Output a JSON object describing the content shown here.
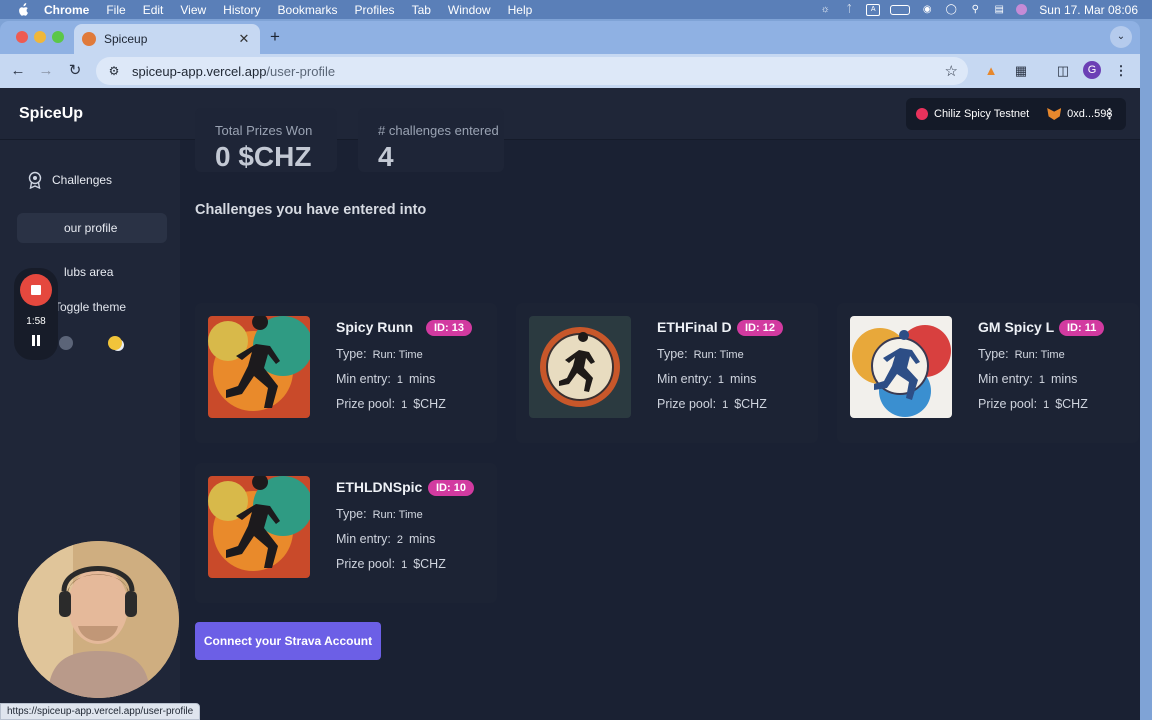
{
  "menubar": {
    "app_name": "Chrome",
    "items": [
      "File",
      "Edit",
      "View",
      "History",
      "Bookmarks",
      "Profiles",
      "Tab",
      "Window",
      "Help"
    ],
    "clock": "Sun 17. Mar  08:06",
    "status_icons": [
      "brightness-icon",
      "bluetooth-icon",
      "text-input-icon",
      "battery-icon",
      "wifi-icon",
      "user-icon",
      "spotlight-icon",
      "control-center-icon",
      "siri-icon"
    ]
  },
  "browser": {
    "tab_title": "Spiceup",
    "url_host": "spiceup-app.vercel.app",
    "url_path": "/user-profile",
    "profile_letter": "G",
    "status_url": "https://spiceup-app.vercel.app/user-profile"
  },
  "app": {
    "brand": "SpiceUp",
    "network": "Chiliz Spicy Testnet",
    "wallet": "0xd...598"
  },
  "sidebar": {
    "items": [
      {
        "label": "Challenges",
        "icon": "award-icon"
      },
      {
        "label": "our profile",
        "icon": "user-icon"
      },
      {
        "label": "lubs area",
        "icon": "clubs-icon"
      }
    ],
    "toggle_theme": "Toggle theme"
  },
  "recorder": {
    "elapsed": "1:58"
  },
  "stats": [
    {
      "label": "Total Prizes Won",
      "value": "0 $CHZ"
    },
    {
      "label": "# challenges entered",
      "value": "4"
    }
  ],
  "section_title": "Challenges you have entered into",
  "labels": {
    "type": "Type:",
    "min_entry": "Min entry:",
    "prize_pool": "Prize pool:",
    "mins": "mins",
    "currency": "$CHZ"
  },
  "challenges": [
    {
      "name": "Spicy Runn",
      "badge": "ID: 13",
      "type": "Run: Time",
      "min_entry": "1",
      "prize_pool": "1"
    },
    {
      "name": "ETHFinal D",
      "badge": "ID: 12",
      "type": "Run: Time",
      "min_entry": "1",
      "prize_pool": "1"
    },
    {
      "name": "GM Spicy L",
      "badge": "ID: 11",
      "type": "Run: Time",
      "min_entry": "1",
      "prize_pool": "1"
    },
    {
      "name": "ETHLDNSpic",
      "badge": "ID: 10",
      "type": "Run: Time",
      "min_entry": "2",
      "prize_pool": "1"
    }
  ],
  "strava_button": "Connect your Strava Account",
  "colors": {
    "page_bg": "#1a2133",
    "badge": "#d23aa0",
    "primary_button": "#6c5fe6",
    "record": "#e5483e"
  }
}
